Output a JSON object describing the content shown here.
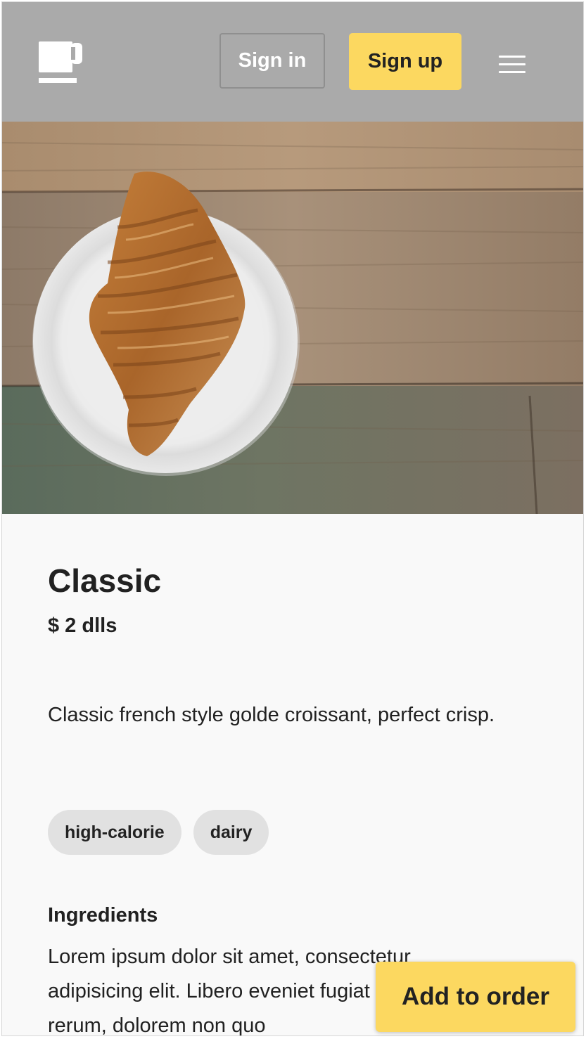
{
  "header": {
    "logo_icon": "coffee-cup-icon",
    "sign_in_label": "Sign in",
    "sign_up_label": "Sign up",
    "menu_icon": "hamburger-menu-icon",
    "background_color": "#aaaaaa",
    "accent_color": "#fcd860"
  },
  "hero": {
    "image_subject": "croissant-on-plate-photo"
  },
  "product": {
    "title": "Classic",
    "price": "$ 2 dlls",
    "description": "Classic french style golde croissant, perfect crisp.",
    "tags": [
      "high-calorie",
      "dairy"
    ],
    "ingredients_heading": "Ingredients",
    "ingredients_text": "Lorem ipsum dolor sit amet, consectetur adipisicing elit. Libero eveniet fugiat corrupti rerum, dolorem non quo"
  },
  "actions": {
    "add_to_order_label": "Add to order"
  }
}
